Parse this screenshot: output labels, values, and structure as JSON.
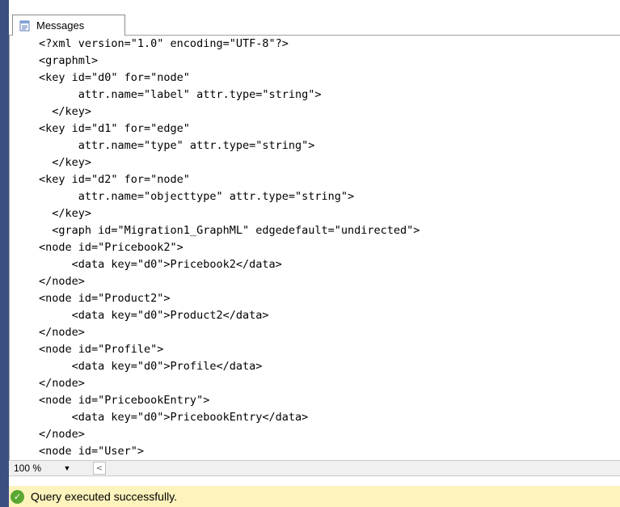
{
  "tab": {
    "label": "Messages",
    "icon": "messages-icon"
  },
  "code_lines": [
    "<?xml version=\"1.0\" encoding=\"UTF-8\"?>",
    "<graphml>",
    "<key id=\"d0\" for=\"node\"",
    "      attr.name=\"label\" attr.type=\"string\">",
    "  </key>",
    "<key id=\"d1\" for=\"edge\"",
    "      attr.name=\"type\" attr.type=\"string\">",
    "  </key>",
    "<key id=\"d2\" for=\"node\"",
    "      attr.name=\"objecttype\" attr.type=\"string\">",
    "  </key>",
    "  <graph id=\"Migration1_GraphML\" edgedefault=\"undirected\">",
    "<node id=\"Pricebook2\">",
    "     <data key=\"d0\">Pricebook2</data>",
    "</node>",
    "<node id=\"Product2\">",
    "     <data key=\"d0\">Product2</data>",
    "</node>",
    "<node id=\"Profile\">",
    "     <data key=\"d0\">Profile</data>",
    "</node>",
    "<node id=\"PricebookEntry\">",
    "     <data key=\"d0\">PricebookEntry</data>",
    "</node>",
    "<node id=\"User\">"
  ],
  "zoom": {
    "value": "100 %",
    "arrow": "▼"
  },
  "scroll_left_arrow": "<",
  "status": {
    "text": "Query executed successfully.",
    "icon": "success-check-icon",
    "color": "#fdf3bc"
  }
}
